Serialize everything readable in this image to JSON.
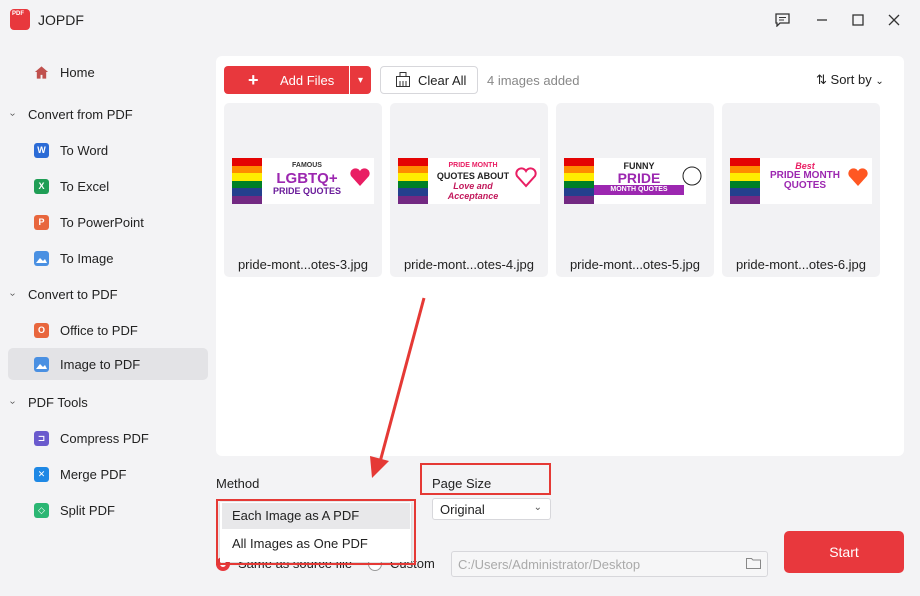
{
  "app": {
    "logo_text": "PDF",
    "title": "JOPDF"
  },
  "sidebar": {
    "home": "Home",
    "sections": [
      {
        "label": "Convert from PDF",
        "items": [
          {
            "label": "To Word",
            "icon": "word-icon",
            "color": "#2b6bd6",
            "glyph": "W"
          },
          {
            "label": "To Excel",
            "icon": "excel-icon",
            "color": "#1f9d55",
            "glyph": "X"
          },
          {
            "label": "To PowerPoint",
            "icon": "powerpoint-icon",
            "color": "#e8663d",
            "glyph": "P"
          },
          {
            "label": "To Image",
            "icon": "image-icon",
            "color": "#4a90e2",
            "glyph": "▲"
          }
        ]
      },
      {
        "label": "Convert to PDF",
        "items": [
          {
            "label": "Office to PDF",
            "icon": "office-icon",
            "color": "#e8663d",
            "glyph": "O"
          },
          {
            "label": "Image to PDF",
            "icon": "image-icon",
            "color": "#4a90e2",
            "glyph": "▲"
          }
        ]
      },
      {
        "label": "PDF Tools",
        "items": [
          {
            "label": "Compress PDF",
            "icon": "compress-icon",
            "color": "#6a5acd",
            "glyph": "⊐"
          },
          {
            "label": "Merge PDF",
            "icon": "merge-icon",
            "color": "#1e88e5",
            "glyph": "✕"
          },
          {
            "label": "Split PDF",
            "icon": "split-icon",
            "color": "#2bb673",
            "glyph": "◇"
          }
        ]
      }
    ]
  },
  "toolbar": {
    "add_files": "Add Files",
    "clear_all": "Clear All",
    "count": "4 images added",
    "sort_by": "Sort by"
  },
  "files": [
    {
      "name": "pride-mont...otes-3.jpg",
      "line1": "FAMOUS",
      "line2": "LGBTQ+",
      "line3": "PRIDE QUOTES"
    },
    {
      "name": "pride-mont...otes-4.jpg",
      "line1": "PRIDE MONTH",
      "line2": "QUOTES ABOUT",
      "line3": "Love and Acceptance"
    },
    {
      "name": "pride-mont...otes-5.jpg",
      "line1": "FUNNY",
      "line2": "PRIDE",
      "line3": "MONTH QUOTES"
    },
    {
      "name": "pride-mont...otes-6.jpg",
      "line1": "Best",
      "line2": "PRIDE MONTH",
      "line3": "QUOTES"
    }
  ],
  "settings": {
    "method_label": "Method",
    "page_size_label": "Page Size",
    "page_size_value": "Original",
    "method_options": [
      "Each Image as A PDF",
      "All Images as One PDF"
    ],
    "output_same": "Same as source file",
    "output_custom": "Custom",
    "output_path": "C:/Users/Administrator/Desktop",
    "start": "Start"
  },
  "colors": {
    "accent": "#e8383d",
    "highlight_box": "#e53935"
  }
}
